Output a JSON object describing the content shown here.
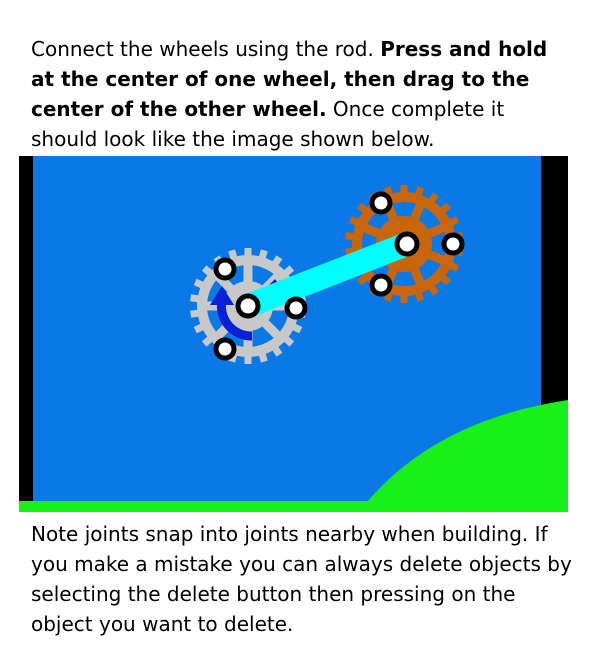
{
  "instructions": {
    "intro": "Connect the wheels using the rod. ",
    "bold": "Press and hold at the center of one wheel, then drag to the center of the other wheel.",
    "outro": " Once complete it should look like the image shown below."
  },
  "note": "Note joints snap into joints nearby when building. If you make a mistake you can always delete objects by selecting the delete button then pressing on the object you want to delete.",
  "colors": {
    "sky": "#0a79e6",
    "wall": "#000000",
    "ground": "#19f019",
    "gray_wheel": "#c8c8c8",
    "orange_wheel": "#c9650a",
    "rod": "#00ffff",
    "arrow": "#0a1fd6"
  },
  "scene": {
    "gray_wheel_icon": "gear-wheel",
    "orange_wheel_icon": "gear-wheel",
    "rod_icon": "rod",
    "arrow_icon": "rotation-arrow"
  }
}
